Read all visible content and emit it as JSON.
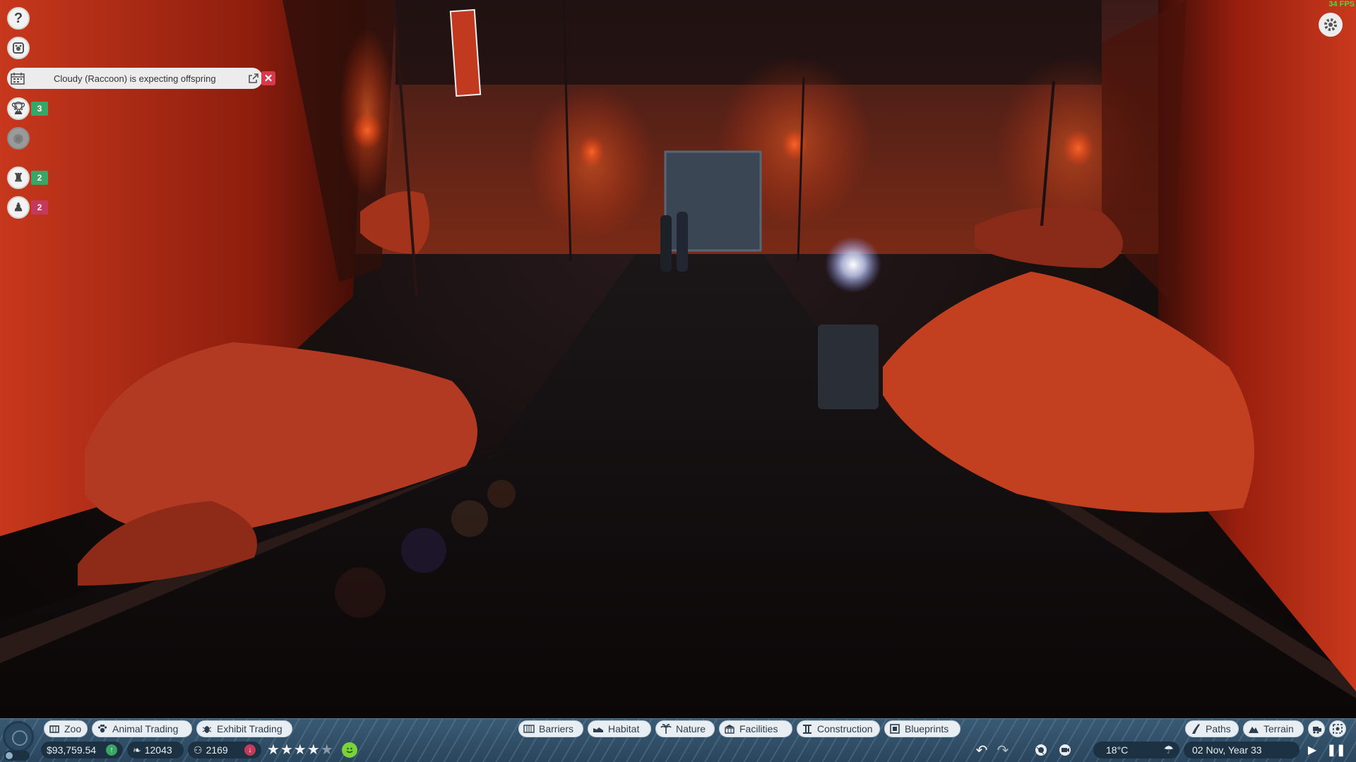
{
  "hud": {
    "fps": "34 FPS"
  },
  "notification": {
    "text": "Cloudy (Raccoon) is expecting offspring"
  },
  "badges": {
    "trophy_count": "3",
    "staff_count": "2",
    "guest_count": "2"
  },
  "toolbar": {
    "left_buttons": [
      "Zoo",
      "Animal Trading",
      "Exhibit Trading"
    ],
    "center_buttons": [
      "Barriers",
      "Habitat",
      "Nature",
      "Facilities",
      "Construction",
      "Blueprints"
    ],
    "right_buttons": [
      "Paths",
      "Terrain"
    ]
  },
  "stats": {
    "money": "$93,759.54",
    "conservation_credits": "12043",
    "guests": "2169",
    "star_rating": 4,
    "star_max": 5
  },
  "environment": {
    "temperature": "18°C",
    "date": "02 Nov, Year 33"
  },
  "colors": {
    "toolbar": "#2f4d66",
    "accent_green": "#3aa564",
    "accent_red": "#c43a5c",
    "close_red": "#d63a4d",
    "fps_green": "#40e040"
  }
}
